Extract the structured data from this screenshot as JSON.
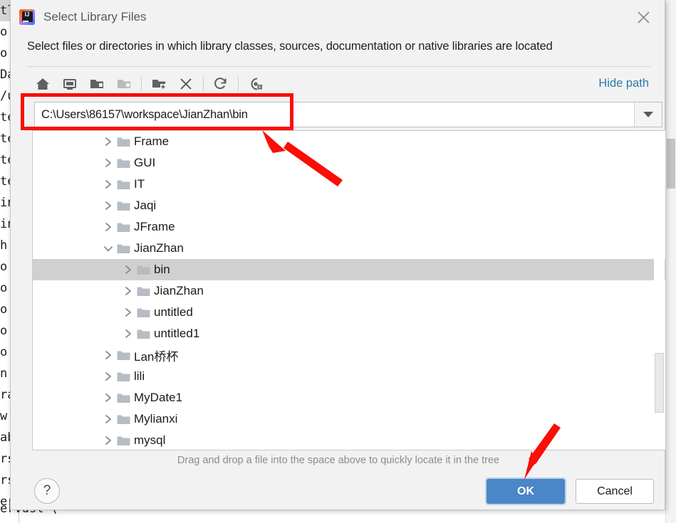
{
  "window": {
    "title": "Select Library Files",
    "app_icon": "intellij-idea-icon",
    "close_icon": "close-icon",
    "subtitle": "Select files or directories in which library classes, sources, documentation or native libraries are located"
  },
  "toolbar": {
    "buttons": [
      {
        "name": "home-icon",
        "tooltip": "Home",
        "enabled": true
      },
      {
        "name": "desktop-icon",
        "tooltip": "Desktop",
        "enabled": true
      },
      {
        "name": "folder-icon",
        "tooltip": "Project directory",
        "enabled": true
      },
      {
        "name": "folder-up-icon",
        "tooltip": "Up",
        "enabled": false
      },
      {
        "name": "new-folder-icon",
        "tooltip": "New Folder",
        "enabled": true
      },
      {
        "name": "delete-icon",
        "tooltip": "Delete",
        "enabled": true
      },
      {
        "name": "refresh-icon",
        "tooltip": "Refresh",
        "enabled": true
      },
      {
        "name": "show-hidden-icon",
        "tooltip": "Show Hidden Files",
        "enabled": true
      }
    ],
    "hide_path_label": "Hide path"
  },
  "path_combo": {
    "value": "C:\\Users\\86157\\workspace\\JianZhan\\bin",
    "placeholder": "",
    "dropdown_icon": "chevron-down-icon"
  },
  "tree": {
    "rows": [
      {
        "label": "Frame",
        "depth": 1,
        "state": "collapsed",
        "selected": false
      },
      {
        "label": "GUI",
        "depth": 1,
        "state": "collapsed",
        "selected": false
      },
      {
        "label": "IT",
        "depth": 1,
        "state": "collapsed",
        "selected": false
      },
      {
        "label": "Jaqi",
        "depth": 1,
        "state": "collapsed",
        "selected": false
      },
      {
        "label": "JFrame",
        "depth": 1,
        "state": "collapsed",
        "selected": false
      },
      {
        "label": "JianZhan",
        "depth": 1,
        "state": "expanded",
        "selected": false
      },
      {
        "label": "bin",
        "depth": 2,
        "state": "collapsed",
        "selected": true
      },
      {
        "label": "JianZhan",
        "depth": 2,
        "state": "collapsed",
        "selected": false
      },
      {
        "label": "untitled",
        "depth": 2,
        "state": "collapsed",
        "selected": false
      },
      {
        "label": "untitled1",
        "depth": 2,
        "state": "collapsed",
        "selected": false
      },
      {
        "label": "Lan桥杯",
        "depth": 1,
        "state": "collapsed",
        "selected": false
      },
      {
        "label": "lili",
        "depth": 1,
        "state": "collapsed",
        "selected": false
      },
      {
        "label": "MyDate1",
        "depth": 1,
        "state": "collapsed",
        "selected": false
      },
      {
        "label": "Mylianxi",
        "depth": 1,
        "state": "collapsed",
        "selected": false
      },
      {
        "label": "mysql",
        "depth": 1,
        "state": "collapsed",
        "selected": false
      }
    ],
    "scrollbar": "tree-vertical-scrollbar"
  },
  "drop_hint": "Drag and drop a file into the space above to quickly locate it in the tree",
  "footer": {
    "help_label": "?",
    "ok_label": "OK",
    "cancel_label": "Cancel"
  },
  "background_editor": {
    "lines": [
      "tl",
      "o",
      "o",
      "Da",
      "/u",
      "te",
      "te",
      "te",
      "te",
      "in",
      "in",
      "h",
      "o",
      "o",
      "o",
      "o",
      "o",
      "n",
      "ra",
      "w",
      "ab",
      "rs",
      "rs",
      "er"
    ],
    "bottom_text": "ervdsl'("
  },
  "annotations": {
    "color": "#fb0d08",
    "highlight_rect_target": "path-combo",
    "arrow1_target": "path-combo",
    "arrow2_target": "ok-button"
  }
}
